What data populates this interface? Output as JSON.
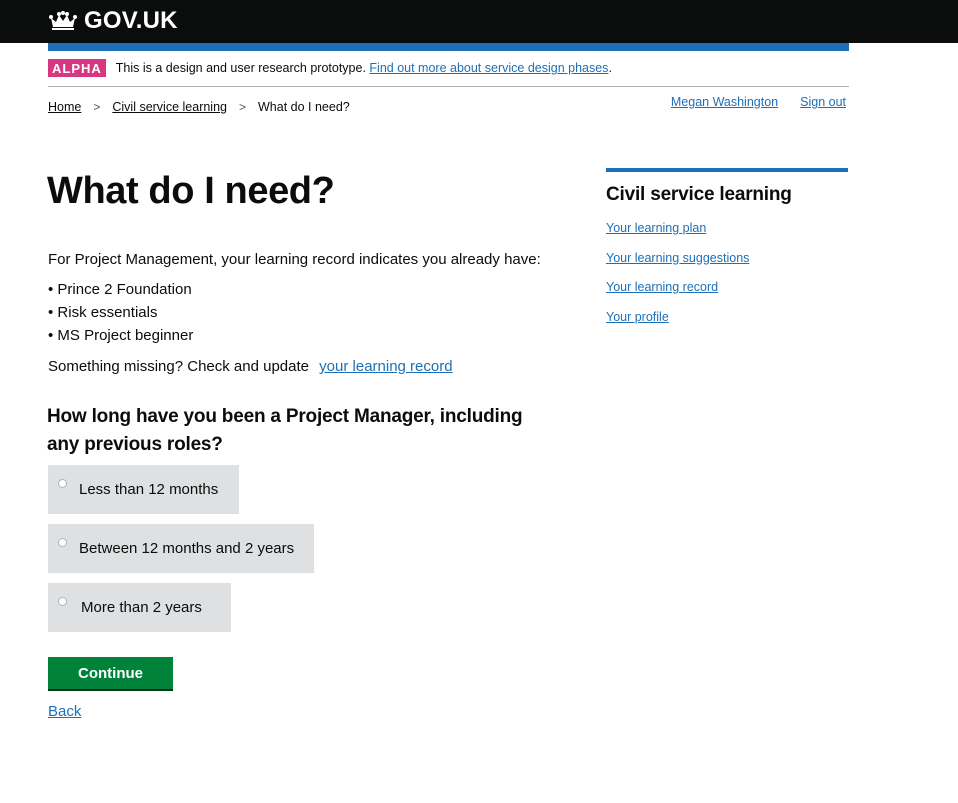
{
  "header": {
    "logo_text": "GOV.UK"
  },
  "phase_banner": {
    "tag": "ALPHA",
    "text": "This is a design and user research prototype.",
    "link": "Find out more about service design phases",
    "suffix": "."
  },
  "breadcrumb": [
    "Home",
    "Civil service learning",
    "What do I need?"
  ],
  "account": {
    "user_name": "Megan Washington",
    "sign_out": "Sign out"
  },
  "main": {
    "title": "What do I need?",
    "intro": "For Project Management, your learning record indicates you already have:",
    "items": [
      "• Prince 2 Foundation",
      "• Risk essentials",
      "• MS Project beginner"
    ],
    "missing_text": "Something missing? Check and update",
    "missing_link": "your learning record",
    "question": "How long have you been a Project Manager, including any previous roles?",
    "options": [
      "Less than 12 months",
      "Between 12 months and 2 years",
      "More than 2 years"
    ],
    "continue_label": "Continue",
    "back_label": "Back"
  },
  "sidebar": {
    "title": "Civil service learning",
    "links": [
      "Your learning plan",
      "Your learning suggestions",
      "Your learning record",
      "Your profile"
    ]
  },
  "colors": {
    "header_bg": "#0b0c0c",
    "brand_blue": "#1d70b8",
    "alpha_tag": "#d53880",
    "button_green": "#00823b",
    "radio_bg": "#dee0e2"
  },
  "icons": {
    "logo": "crown-icon"
  }
}
